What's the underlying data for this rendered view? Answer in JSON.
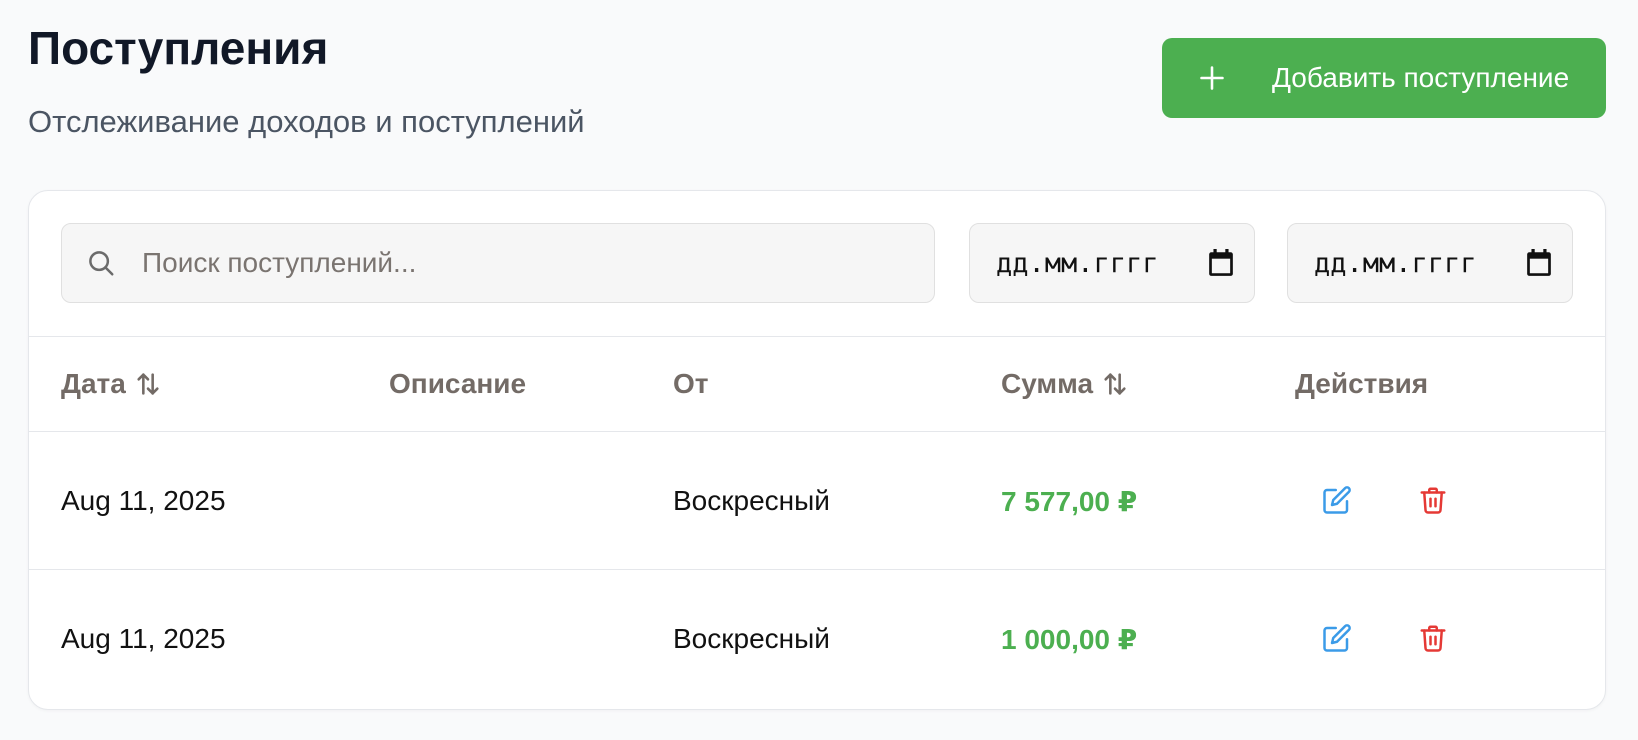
{
  "header": {
    "title": "Поступления",
    "subtitle": "Отслеживание доходов и поступлений"
  },
  "add_button": {
    "label": "Добавить поступление",
    "icon": "plus-icon",
    "color": "#4caf50"
  },
  "filters": {
    "search": {
      "placeholder": "Поиск поступлений...",
      "value": "",
      "icon": "search-icon"
    },
    "date_from": {
      "placeholder": "дд.мм.гггг",
      "icon": "calendar-icon"
    },
    "date_to": {
      "placeholder": "дд.мм.гггг",
      "icon": "calendar-icon"
    }
  },
  "table": {
    "columns": [
      {
        "label": "Дата",
        "sortable": true
      },
      {
        "label": "Описание",
        "sortable": false
      },
      {
        "label": "От",
        "sortable": false
      },
      {
        "label": "Сумма",
        "sortable": true
      },
      {
        "label": "Действия",
        "sortable": false
      }
    ],
    "rows": [
      {
        "date": "Aug 11, 2025",
        "description": "",
        "from": "Воскресный",
        "amount": "7 577,00 ₽"
      },
      {
        "date": "Aug 11, 2025",
        "description": "",
        "from": "Воскресный",
        "amount": "1 000,00 ₽"
      }
    ],
    "amount_color": "#4caf50",
    "edit_icon": "edit-icon",
    "edit_color": "#3b9be8",
    "delete_icon": "trash-icon",
    "delete_color": "#e53935"
  }
}
